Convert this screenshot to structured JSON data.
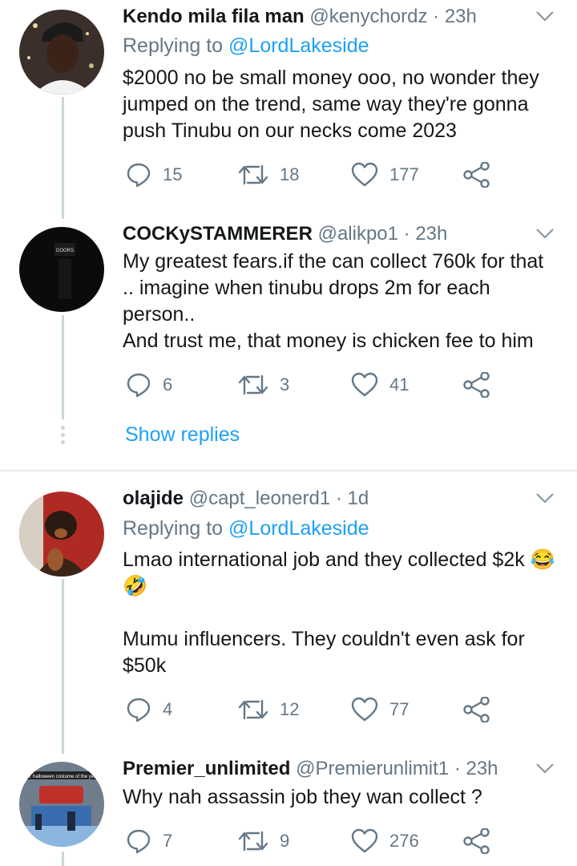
{
  "colors": {
    "accent": "#1da1f2",
    "muted": "#657786",
    "text": "#14171a",
    "line": "#ccd6dd"
  },
  "tweets": [
    {
      "name": "Kendo mila fila man",
      "handle": "@kenychordz",
      "time": "· 23h",
      "reply_prefix": "Replying to ",
      "reply_handle": "@LordLakeside",
      "body": [
        "$2000 no be small money ooo, no wonder they jumped on the trend, same way they're gonna push Tinubu on our necks come 2023"
      ],
      "replies": "15",
      "retweets": "18",
      "likes": "177"
    },
    {
      "name": "COCKySTAMMERER",
      "handle": "@alikpo1",
      "time": "· 23h",
      "avatar_text": "DOORS",
      "body": [
        "My greatest fears.if the can collect 760k for that .. imagine when tinubu drops 2m for each person..",
        "And trust me, that money is chicken fee to him"
      ],
      "replies": "6",
      "retweets": "3",
      "likes": "41"
    },
    {
      "name": "olajide",
      "handle": "@capt_leonerd1",
      "time": "· 1d",
      "reply_prefix": "Replying to ",
      "reply_handle": "@LordLakeside",
      "body": [
        "Lmao international job and they collected $2k 😂🤣",
        "",
        "Mumu influencers. They couldn't even ask for $50k"
      ],
      "replies": "4",
      "retweets": "12",
      "likes": "77"
    },
    {
      "name": "Premier_unlimited",
      "handle": "@Premierunlimit1",
      "time": "· 23h",
      "avatar_text": "bes: halloween costume of the year",
      "body": [
        "Why nah assassin job they wan collect ?"
      ],
      "replies": "7",
      "retweets": "9",
      "likes": "276"
    }
  ],
  "show_replies": "Show replies",
  "icons": [
    "reply-icon",
    "retweet-icon",
    "like-icon",
    "share-icon",
    "chevron-down-icon"
  ]
}
